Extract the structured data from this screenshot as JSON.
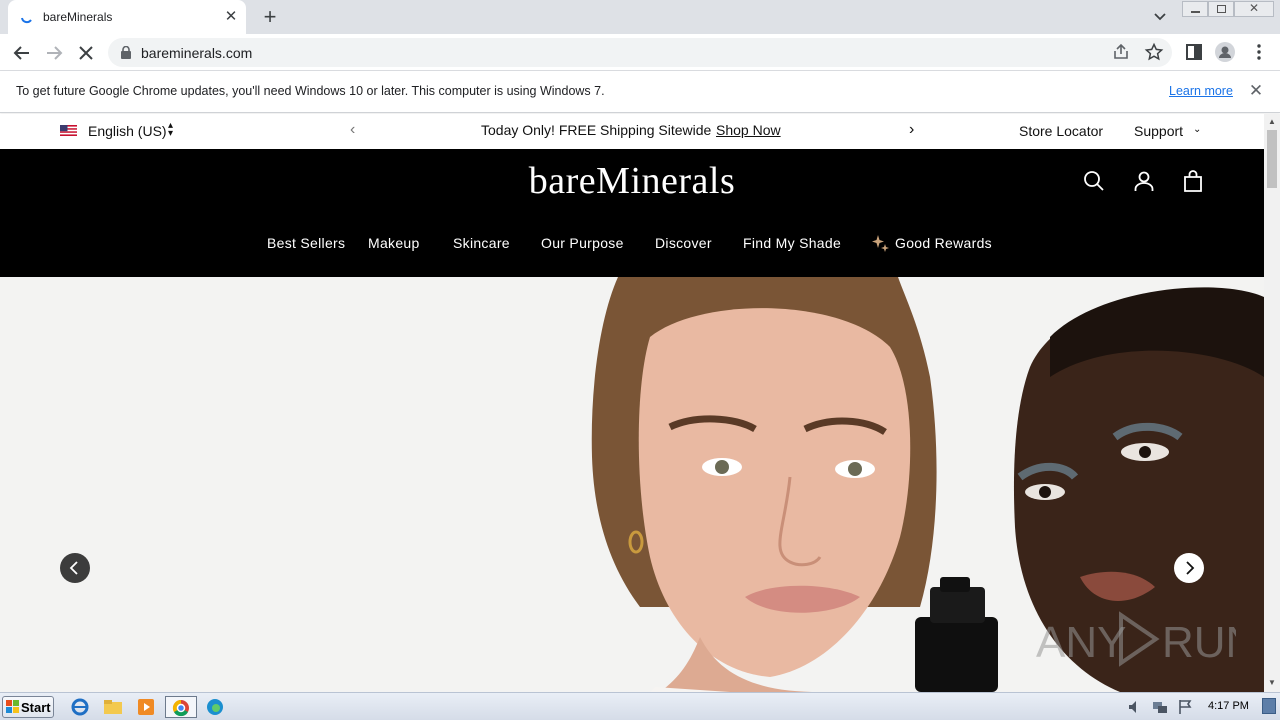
{
  "browser": {
    "tab_title": "bareMinerals",
    "url": "bareminerals.com"
  },
  "infobar": {
    "message": "To get future Google Chrome updates, you'll need Windows 10 or later. This computer is using Windows 7.",
    "link": "Learn more"
  },
  "promobar": {
    "language": "English (US)",
    "promo_text": "Today Only! FREE Shipping Sitewide",
    "promo_link": "Shop Now",
    "store_locator": "Store Locator",
    "support": "Support"
  },
  "header": {
    "logo": "bareMinerals"
  },
  "nav": {
    "items": [
      "Best Sellers",
      "Makeup",
      "Skincare",
      "Our Purpose",
      "Discover",
      "Find My Shade",
      "Good Rewards"
    ]
  },
  "watermark": "ANY RUN",
  "taskbar": {
    "start_label": "Start",
    "clock": "4:17 PM"
  },
  "colors": {
    "header_bg": "#000000",
    "link_blue": "#1a73e8",
    "hero_bg": "#f3f3f2"
  }
}
